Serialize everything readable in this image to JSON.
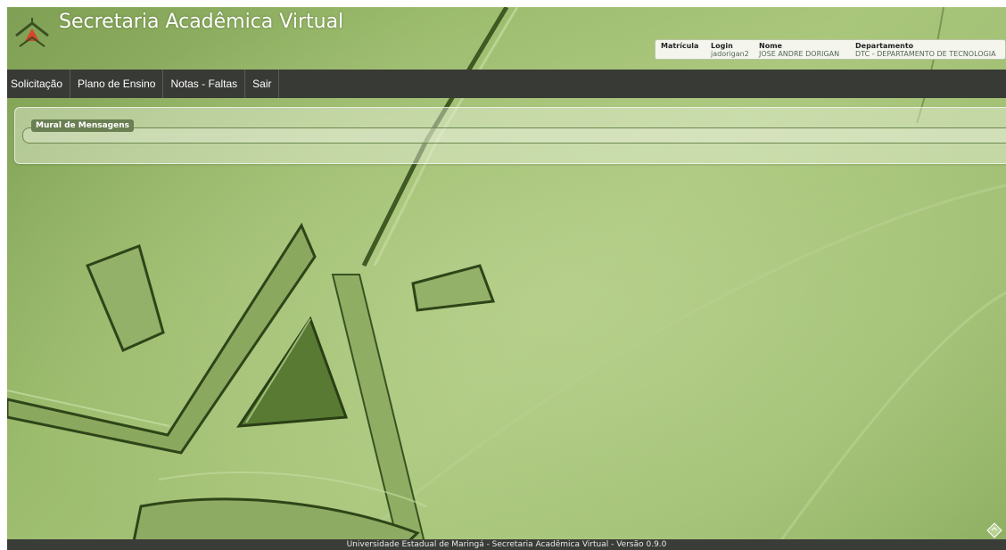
{
  "header": {
    "title": "Secretaria Acadêmica Virtual",
    "logo_icon": "uem-logo-icon"
  },
  "user_info": {
    "matricula_label": "Matrícula",
    "login_label": "Login",
    "login_value": "jadorigan2",
    "nome_label": "Nome",
    "nome_value": "JOSE ANDRE DORIGAN",
    "departamento_label": "Departamento",
    "departamento_value": "DTC - DEPARTAMENTO DE TECNOLOGIA"
  },
  "menu": {
    "items": [
      {
        "label": "Solicitação"
      },
      {
        "label": "Plano de Ensino"
      },
      {
        "label": "Notas - Faltas"
      },
      {
        "label": "Sair"
      }
    ]
  },
  "mural": {
    "title": "Mural de Mensagens"
  },
  "footer": {
    "text": "Universidade Estadual de Maringá - Secretaria Acadêmica Virtual - Versão 0.9.0"
  },
  "colors": {
    "menu_bg": "#383a36",
    "background_green": "#9bbb6c",
    "legend_bg": "#6a7f52",
    "logo_accent": "#d8452b"
  }
}
